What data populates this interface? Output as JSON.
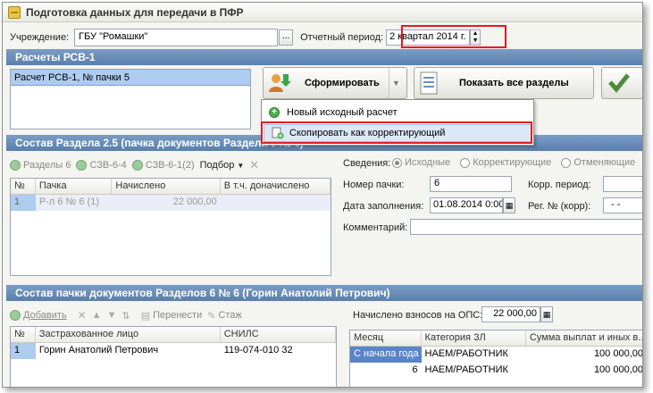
{
  "window": {
    "title": "Подготовка данных для передачи в ПФР"
  },
  "header": {
    "institution_label": "Учреждение:",
    "institution_value": "ГБУ \"Ромашки\"",
    "ellipsis": "...",
    "period_label": "Отчетный период:",
    "period_value": "2 квартал 2014 г."
  },
  "rsv": {
    "section_title": "Расчеты РСВ-1",
    "list_items": [
      "Расчет РСВ-1, № пачки 5"
    ],
    "generate_button": "Сформировать",
    "show_all_button": "Показать все разделы",
    "menu": {
      "item_new": "Новый исходный расчет",
      "item_copy": "Скопировать как корректирующий"
    }
  },
  "section25": {
    "title": "Состав Раздела 2.5    (пачка документов Раздела 6 № 6)",
    "toolbar": {
      "sections6": "Разделы 6",
      "szv64": "СЗВ-6-4",
      "szv61": "СЗВ-6-1(2)",
      "select": "Подбор"
    },
    "columns": [
      "№",
      "Пачка",
      "Начислено",
      "В т.ч. доначислено"
    ],
    "rows": [
      {
        "n": "1",
        "pack": "Р-л 6 № 6 (1)",
        "accrued": "22 000,00",
        "extra": ""
      }
    ],
    "info": {
      "label": "Сведения:",
      "radio_source": "Исходные",
      "radio_corrective": "Корректирующие",
      "radio_cancel": "Отменяющие",
      "pack_number_label": "Номер пачки:",
      "pack_number_value": "6",
      "corr_period_label": "Корр. период:",
      "fill_date_label": "Дата заполнения:",
      "fill_date_value": "01.08.2014 0:00",
      "reg_number_label": "Рег. № (корр):",
      "reg_number_value": "-  -",
      "comment_label": "Комментарий:"
    }
  },
  "pack6": {
    "title": "Состав пачки документов Разделов 6 № 6     (Горин Анатолий Петрович)",
    "toolbar": {
      "add": "Добавить",
      "move": "Перенести",
      "experience": "Стаж"
    },
    "columns": [
      "№",
      "Застрахованное лицо",
      "СНИЛС"
    ],
    "rows": [
      {
        "n": "1",
        "person": "Горин Анатолий Петрович",
        "snils": "119-074-010 32"
      }
    ],
    "ops_label": "Начислено взносов на ОПС:",
    "ops_value": "22 000,00",
    "right_columns": [
      "Месяц",
      "Категория ЗЛ",
      "Сумма выплат и иных в..."
    ],
    "right_rows": [
      {
        "month": "С начала года",
        "category": "НАЕМ/РАБОТНИК",
        "sum": "100 000,00"
      },
      {
        "month": "6",
        "category": "НАЕМ/РАБОТНИК",
        "sum": "100 000,00"
      }
    ]
  }
}
